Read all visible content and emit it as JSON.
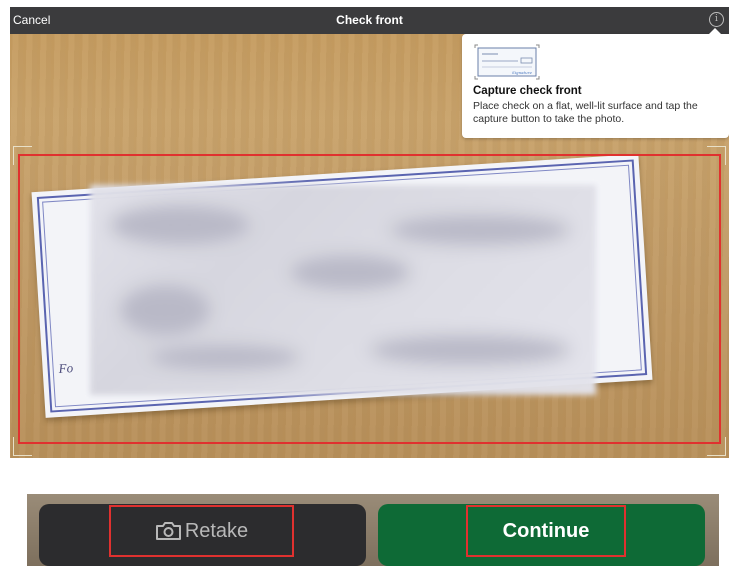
{
  "header": {
    "cancel_label": "Cancel",
    "title": "Check front",
    "info_icon": "info-icon"
  },
  "tooltip": {
    "title": "Capture check front",
    "text": "Place check on a flat, well-lit surface and tap the capture button to take the photo.",
    "illustration": "check-illustration-icon",
    "illustration_signature": "Signature"
  },
  "check_image": {
    "partial_text": "Fo"
  },
  "actions": {
    "retake_label": "Retake",
    "retake_icon": "camera-icon",
    "continue_label": "Continue"
  },
  "colors": {
    "highlight": "#e0312f",
    "continue_bg": "#0e6a36",
    "retake_bg": "#2c2c2e",
    "topbar_bg": "#3b3b3d"
  }
}
